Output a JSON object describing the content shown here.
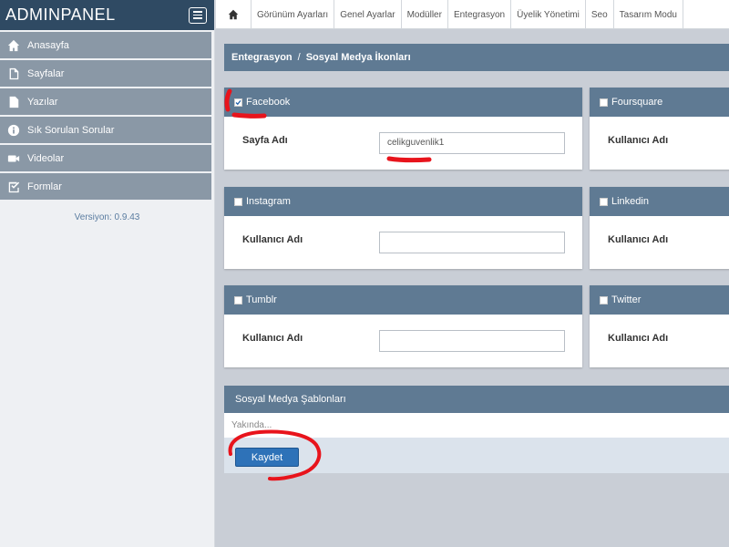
{
  "app": {
    "title": "ADMINPANEL",
    "version": "Versiyon: 0.9.43"
  },
  "sidebar": {
    "items": [
      {
        "label": "Anasayfa",
        "icon": "home-icon"
      },
      {
        "label": "Sayfalar",
        "icon": "file-icon"
      },
      {
        "label": "Yazılar",
        "icon": "document-icon"
      },
      {
        "label": "Sık Sorulan Sorular",
        "icon": "info-icon"
      },
      {
        "label": "Videolar",
        "icon": "video-icon"
      },
      {
        "label": "Formlar",
        "icon": "check-square-icon"
      }
    ]
  },
  "topnav": {
    "items": [
      "Görünüm Ayarları",
      "Genel Ayarlar",
      "Modüller",
      "Entegrasyon",
      "Üyelik Yönetimi",
      "Seo",
      "Tasarım Modu"
    ]
  },
  "breadcrumb": {
    "parent": "Entegrasyon",
    "separator": "/",
    "current": "Sosyal Medya İkonları"
  },
  "panels": {
    "facebook": {
      "title": "Facebook",
      "checked": true,
      "label": "Sayfa Adı",
      "value": "celikguvenlik1"
    },
    "foursquare": {
      "title": "Foursquare",
      "checked": false,
      "label": "Kullanıcı Adı"
    },
    "instagram": {
      "title": "Instagram",
      "checked": false,
      "label": "Kullanıcı Adı",
      "value": ""
    },
    "linkedin": {
      "title": "Linkedin",
      "checked": false,
      "label": "Kullanıcı Adı"
    },
    "tumblr": {
      "title": "Tumblr",
      "checked": false,
      "label": "Kullanıcı Adı",
      "value": ""
    },
    "twitter": {
      "title": "Twitter",
      "checked": false,
      "label": "Kullanıcı Adı"
    }
  },
  "templates": {
    "title": "Sosyal Medya Şablonları",
    "message": "Yakında..."
  },
  "save_label": "Kaydet",
  "colors": {
    "header": "#2f4a63",
    "panel_head": "#5f7a93",
    "sidebar_item": "#8a98a6",
    "button": "#2e72b8",
    "annotation": "#e8141c"
  }
}
